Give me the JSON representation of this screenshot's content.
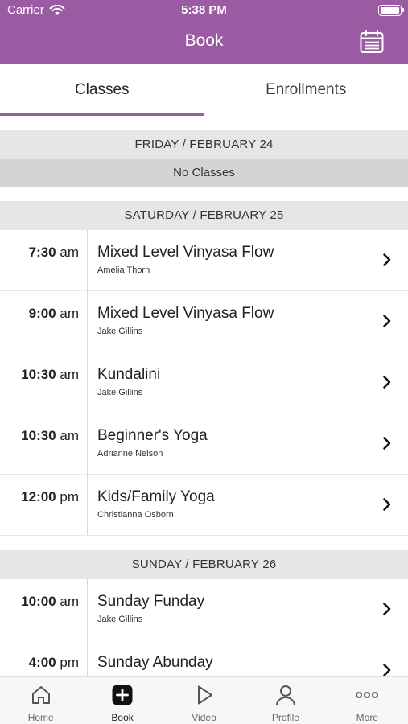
{
  "status_bar": {
    "carrier": "Carrier",
    "time": "5:38 PM"
  },
  "header": {
    "title": "Book"
  },
  "tabs": [
    {
      "label": "Classes",
      "active": true
    },
    {
      "label": "Enrollments",
      "active": false
    }
  ],
  "days": [
    {
      "header": "FRIDAY / FEBRUARY 24",
      "empty_text": "No Classes",
      "classes": []
    },
    {
      "header": "SATURDAY / FEBRUARY 25",
      "classes": [
        {
          "time": "7:30",
          "ampm": "am",
          "name": "Mixed Level Vinyasa Flow",
          "teacher": "Amelia Thorn"
        },
        {
          "time": "9:00",
          "ampm": "am",
          "name": "Mixed Level Vinyasa Flow",
          "teacher": "Jake Gillins"
        },
        {
          "time": "10:30",
          "ampm": "am",
          "name": "Kundalini",
          "teacher": "Jake Gillins"
        },
        {
          "time": "10:30",
          "ampm": "am",
          "name": "Beginner's Yoga",
          "teacher": "Adrianne Nelson"
        },
        {
          "time": "12:00",
          "ampm": "pm",
          "name": "Kids/Family Yoga",
          "teacher": "Christianna Osborn"
        }
      ]
    },
    {
      "header": "SUNDAY / FEBRUARY 26",
      "classes": [
        {
          "time": "10:00",
          "ampm": "am",
          "name": "Sunday Funday",
          "teacher": "Jake Gillins"
        },
        {
          "time": "4:00",
          "ampm": "pm",
          "name": "Sunday Abunday",
          "teacher": ""
        }
      ]
    }
  ],
  "tab_bar": [
    {
      "label": "Home",
      "icon": "home-icon"
    },
    {
      "label": "Book",
      "icon": "plus-square-icon",
      "active": true
    },
    {
      "label": "Video",
      "icon": "play-icon"
    },
    {
      "label": "Profile",
      "icon": "person-icon"
    },
    {
      "label": "More",
      "icon": "more-dots-icon"
    }
  ],
  "colors": {
    "accent": "#9a5ba3",
    "header_text": "#ffffff",
    "day_header_bg": "#e6e6e6",
    "no_classes_bg": "#d4d4d4"
  }
}
